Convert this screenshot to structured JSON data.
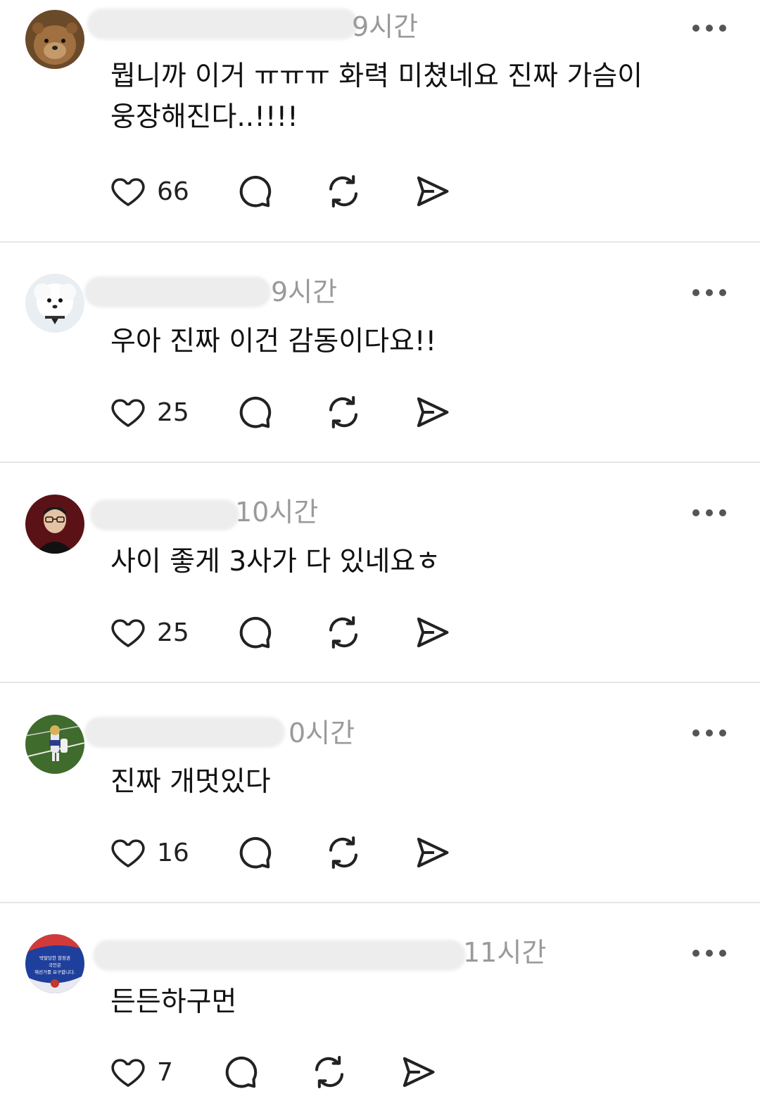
{
  "comments": [
    {
      "time": "9시간",
      "text_lines": [
        "뭡니까 이거 ㅠㅠㅠ 화력 미쳤네요 진짜 가슴이",
        "웅장해진다..!!!!"
      ],
      "likes": "66",
      "avatar": "quokka-avatar"
    },
    {
      "time": "9시간",
      "text_lines": [
        "우아 진짜 이건 감동이다요!!"
      ],
      "likes": "25",
      "avatar": "white-dog-avatar"
    },
    {
      "time": "10시간",
      "text_lines": [
        "사이 좋게 3사가 다 있네요ㅎ"
      ],
      "likes": "25",
      "avatar": "man-glasses-avatar"
    },
    {
      "time": "0시간",
      "text_lines": [
        "진짜 개멋있다"
      ],
      "likes": "16",
      "avatar": "stadium-mascot-avatar"
    },
    {
      "time": "11시간",
      "text_lines": [
        "든든하구먼"
      ],
      "likes": "7",
      "avatar": "badge-avatar",
      "avatar_text": [
        "박탈당한 참정권",
        "국민은",
        "재선거를 요구합니다."
      ]
    }
  ],
  "icons": {
    "like": "heart-icon",
    "reply": "comment-icon",
    "repost": "repost-icon",
    "share": "share-icon",
    "more": "more-dots-icon"
  },
  "colors": {
    "timestamp": "#9a9a9a",
    "divider": "#e6e6e6",
    "icon": "#222222"
  }
}
